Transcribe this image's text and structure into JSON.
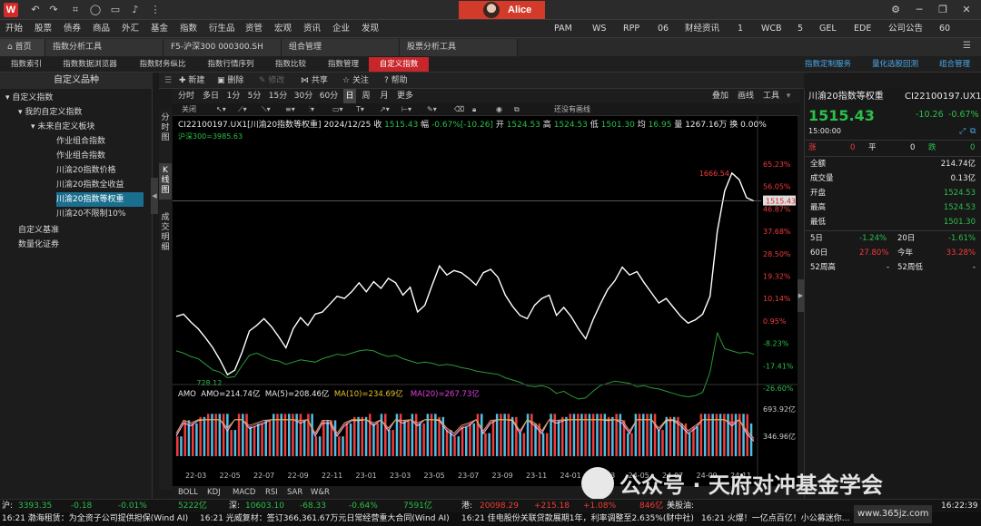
{
  "titlebar": {
    "logo": "W",
    "user": "Alice"
  },
  "menu": [
    "开始",
    "股票",
    "债券",
    "商品",
    "外汇",
    "基金",
    "指数",
    "衍生品",
    "资管",
    "宏观",
    "资讯",
    "企业",
    "发现"
  ],
  "menu_right": [
    "PAM",
    "WS",
    "RPP",
    "06",
    "财经资讯",
    "1",
    "WCB",
    "5",
    "GEL",
    "EDE",
    "公司公告",
    "60"
  ],
  "tabs": [
    "首页",
    "指数分析工具",
    "F5-沪深300 000300.SH",
    "组合管理",
    "股票分析工具"
  ],
  "subtabs": [
    "指数索引",
    "指数数据浏览器",
    "指数财务纵比",
    "指数行情序列",
    "指数比较",
    "指数管理",
    "自定义指数"
  ],
  "subtabs_right": [
    "指数定制服务",
    "量化选股回测",
    "组合管理"
  ],
  "sidebar": {
    "header": "自定义品种",
    "items": [
      "自定义指数",
      "我的自定义指数",
      "未来自定义板块",
      "作业组合指数",
      "作业组合指数",
      "川渝20指数价格",
      "川渝20指数全收益",
      "川渝20指数等权重",
      "川渝20不限制10%",
      "自定义基准",
      "数量化证券"
    ]
  },
  "vtabs": [
    "分时图",
    "K线图",
    "成交明细"
  ],
  "ctoolbar": {
    "new": "新建",
    "delete": "删除",
    "modify": "修改",
    "share": "共享",
    "follow": "关注",
    "help": "帮助",
    "right": [
      "叠加",
      "画线",
      "工具"
    ]
  },
  "periods": [
    "分时",
    "多日",
    "1分",
    "5分",
    "15分",
    "30分",
    "60分",
    "日",
    "周",
    "月",
    "更多"
  ],
  "drawbar": {
    "close": "关闭",
    "restore": "还没有画线"
  },
  "info": {
    "code": "CI22100197.UX1[川渝20指数等权重]",
    "date": "2024/12/25",
    "close_label": "收",
    "close": "1515.43",
    "amp_label": "幅",
    "amp": "-0.67%[-10.26]",
    "open_label": "开",
    "open": "1524.53",
    "high_label": "高",
    "high": "1524.53",
    "low_label": "低",
    "low": "1501.30",
    "avg_label": "均",
    "avg": "16.95",
    "vol_label": "量",
    "vol": "1267.16万",
    "turn_label": "换",
    "turn": "0.00%",
    "compare": "沪深300=3985.63"
  },
  "annotations": {
    "high_mark": "1666.54",
    "low_mark": "728.12",
    "current": "1515.43"
  },
  "amo": {
    "label": "AMO",
    "amo": "AMO=214.74亿",
    "ma5": "MA(5)=208.46亿",
    "ma10": "MA(10)=234.69亿",
    "ma20": "MA(20)=267.73亿"
  },
  "bottom_tabs": [
    "BOLL",
    "KDJ",
    "MACD",
    "RSI",
    "SAR",
    "W&R"
  ],
  "right_panel": {
    "title": "川渝20指数等权重",
    "code": "CI22100197.UX1",
    "price": "1515.43",
    "change": "-10.26",
    "pct": "-0.67%",
    "time": "15:00:00",
    "up_label": "涨",
    "up": "0",
    "flat_label": "平",
    "flat": "0",
    "down_label": "跌",
    "down": "0",
    "rows": [
      {
        "k": "全额",
        "v": "214.74亿"
      },
      {
        "k": "成交量",
        "v": "0.13亿"
      },
      {
        "k": "开盘",
        "v": "1524.53"
      },
      {
        "k": "最高",
        "v": "1524.53"
      },
      {
        "k": "最低",
        "v": "1501.30"
      }
    ],
    "perf": [
      {
        "k": "5日",
        "v": "-1.24%",
        "k2": "20日",
        "v2": "-1.61%"
      },
      {
        "k": "60日",
        "v": "27.80%",
        "k2": "今年",
        "v2": "33.28%"
      },
      {
        "k": "52周高",
        "v": "-",
        "k2": "52周低",
        "v2": "-"
      }
    ]
  },
  "status": {
    "sh_label": "沪:",
    "sh": "3393.35",
    "sh_chg": "-0.18",
    "sh_pct": "-0.01%",
    "sh_amt": "5222亿",
    "sz_label": "深:",
    "sz": "10603.10",
    "sz_chg": "-68.33",
    "sz_pct": "-0.64%",
    "sz_amt": "7591亿",
    "hk_label": "港:",
    "hk": "20098.29",
    "hk_chg": "+215.18",
    "hk_pct": "+1.08%",
    "hk_amt": "846亿",
    "us_label": "美股油:",
    "time": "16:22:39"
  },
  "ticker": [
    "16:21  渤海租赁：为全资子公司提供担保(Wind AI)",
    "16:21  光威复材：签订366,361.67万元日常经营重大合同(Wind AI)",
    "16:21  佳电股份关联贷款展期1年，利率调整至2.635%(财中社)",
    "16:21  火爆！一亿点百亿！小公募迷你..."
  ],
  "watermark": {
    "text": "公众号 · 天府对冲基金学会",
    "site": "www.365jz.com"
  },
  "chart_data": {
    "type": "line",
    "title": "CI22100197.UX1[川渝20指数等权重]",
    "x_ticks": [
      "22-03",
      "22-05",
      "22-07",
      "22-09",
      "22-11",
      "23-01",
      "23-03",
      "23-05",
      "23-07",
      "23-09",
      "23-11",
      "24-01",
      "24-03",
      "24-05",
      "24-07",
      "24-09",
      "24-11"
    ],
    "y_ticks_pct": [
      "65.23%",
      "56.05%",
      "46.87%",
      "37.68%",
      "28.50%",
      "19.32%",
      "10.14%",
      "0.95%",
      "-8.23%",
      "-17.41%",
      "-26.60%"
    ],
    "volume_ticks": [
      "693.92亿",
      "346.96亿"
    ],
    "series": [
      {
        "name": "川渝20指数等权重",
        "color": "#ffffff",
        "values": [
          1000,
          1010,
          975,
          945,
          905,
          860,
          805,
          740,
          760,
          840,
          935,
          960,
          990,
          955,
          910,
          860,
          945,
          995,
          960,
          1010,
          1020,
          1055,
          1090,
          1080,
          1110,
          1150,
          1110,
          1155,
          1125,
          1170,
          1150,
          1095,
          1130,
          1020,
          1050,
          1140,
          1225,
          1185,
          1205,
          1195,
          1170,
          1140,
          1195,
          1210,
          1175,
          1095,
          1045,
          1005,
          990,
          1050,
          1080,
          1095,
          1005,
          1040,
          1000,
          945,
          900,
          985,
          1055,
          1120,
          1160,
          1220,
          1185,
          1200,
          1150,
          1105,
          1060,
          1080,
          1040,
          1000,
          970,
          985,
          1010,
          1090,
          1380,
          1560,
          1640,
          1610,
          1530,
          1515.43
        ]
      },
      {
        "name": "沪深300",
        "color": "#2a9a3a",
        "values": [
          1000,
          990,
          975,
          965,
          940,
          915,
          905,
          880,
          885,
          935,
          980,
          990,
          975,
          960,
          955,
          940,
          950,
          960,
          955,
          950,
          965,
          975,
          985,
          980,
          990,
          1000,
          1005,
          1000,
          985,
          975,
          980,
          965,
          955,
          945,
          950,
          945,
          935,
          940,
          935,
          925,
          920,
          910,
          905,
          900,
          895,
          880,
          870,
          860,
          845,
          840,
          845,
          835,
          810,
          820,
          800,
          785,
          790,
          820,
          845,
          855,
          865,
          860,
          855,
          840,
          845,
          835,
          830,
          820,
          810,
          800,
          795,
          800,
          815,
          905,
          1080,
          1010,
          1000,
          990,
          995,
          985
        ]
      }
    ],
    "volume": {
      "series_colors": [
        "#e8e8e8",
        "#e040e0",
        "#2bbf4a",
        "#e6c229"
      ]
    }
  }
}
